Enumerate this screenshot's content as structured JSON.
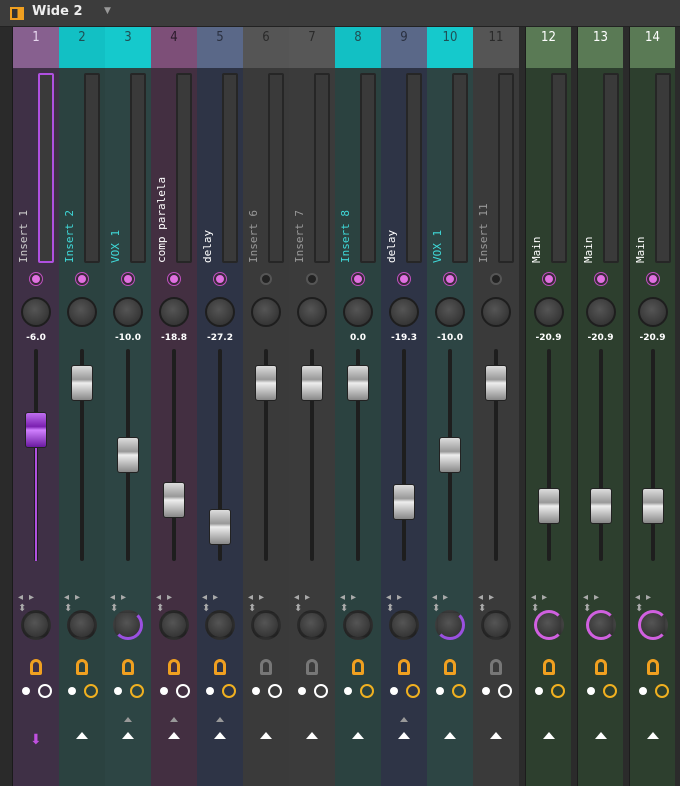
{
  "topbar": {
    "preset_name": "Wide 2"
  },
  "colors": {
    "accent": "#f0a020",
    "selected": "#b050e0",
    "pan_arc": "#9a50e0"
  },
  "strips": [
    {
      "num": "1",
      "name": "Insert 1",
      "vol": "-6.0",
      "hdr": "#87608f",
      "body": "#3f3046",
      "txt": "#e8d8f0",
      "ncol": "#ccc",
      "fader": 0.62,
      "led": true,
      "fx": true,
      "clock": "w",
      "pan": 0,
      "sel": true
    },
    {
      "num": "2",
      "name": "Insert 2",
      "vol": "",
      "hdr": "#12c0c4",
      "body": "#2b4240",
      "txt": "#1f4f55",
      "ncol": "#3fd8d8",
      "fader": 0.84,
      "led": true,
      "fx": true,
      "clock": "y",
      "pan": 0
    },
    {
      "num": "3",
      "name": "VOX 1",
      "vol": "-10.0",
      "hdr": "#15c9cc",
      "body": "#2d4544",
      "txt": "#1f4f55",
      "ncol": "#3fd8d8",
      "fader": 0.5,
      "led": true,
      "fx": true,
      "clock": "y",
      "pan": 0.5,
      "up2": true
    },
    {
      "num": "4",
      "name": "comp paralela",
      "vol": "-18.8",
      "hdr": "#7d4f78",
      "body": "#432f41",
      "txt": "#2a1a2a",
      "ncol": "#fff",
      "fader": 0.29,
      "led": true,
      "fx": true,
      "clock": "w",
      "pan": 0,
      "up2": true
    },
    {
      "num": "5",
      "name": "delay",
      "vol": "-27.2",
      "hdr": "#5a6888",
      "body": "#2e3446",
      "txt": "#2a3040",
      "ncol": "#fff",
      "fader": 0.16,
      "led": true,
      "fx": true,
      "clock": "y",
      "pan": 0,
      "up2": true
    },
    {
      "num": "6",
      "name": "Insert 6",
      "vol": "",
      "hdr": "#555",
      "body": "#3a3a3a",
      "txt": "#2a2a2a",
      "ncol": "#999",
      "fader": 0.84,
      "led": false,
      "fx": false,
      "clock": "w",
      "pan": 0
    },
    {
      "num": "7",
      "name": "Insert 7",
      "vol": "",
      "hdr": "#575757",
      "body": "#3b3b3b",
      "txt": "#2a2a2a",
      "ncol": "#999",
      "fader": 0.84,
      "led": false,
      "fx": false,
      "clock": "w",
      "pan": 0
    },
    {
      "num": "8",
      "name": "Insert 8",
      "vol": "0.0",
      "hdr": "#12c0c4",
      "body": "#2b4240",
      "txt": "#1f4f55",
      "ncol": "#3fd8d8",
      "fader": 0.84,
      "led": true,
      "fx": true,
      "clock": "y",
      "pan": 0
    },
    {
      "num": "9",
      "name": "delay",
      "vol": "-19.3",
      "hdr": "#5a6888",
      "body": "#2e3446",
      "txt": "#2a3040",
      "ncol": "#fff",
      "fader": 0.28,
      "led": true,
      "fx": true,
      "clock": "y",
      "pan": 0,
      "up2": true
    },
    {
      "num": "10",
      "name": "VOX 1",
      "vol": "-10.0",
      "hdr": "#15c9cc",
      "body": "#2d4544",
      "txt": "#1f4f55",
      "ncol": "#3fd8d8",
      "fader": 0.5,
      "led": true,
      "fx": true,
      "clock": "y",
      "pan": 0.5
    },
    {
      "num": "11",
      "name": "Insert 11",
      "vol": "",
      "hdr": "#555",
      "body": "#3a3a3a",
      "txt": "#2a2a2a",
      "ncol": "#999",
      "fader": 0.84,
      "led": false,
      "fx": false,
      "clock": "w",
      "pan": 0
    },
    {
      "num": "12",
      "name": "Main",
      "vol": "-20.9",
      "hdr": "#5a7a55",
      "body": "#2d3f2e",
      "txt": "#fff",
      "ncol": "#fff",
      "fader": 0.26,
      "led": true,
      "fx": true,
      "clock": "y",
      "pan": -1,
      "main": true
    },
    {
      "num": "13",
      "name": "Main",
      "vol": "-20.9",
      "hdr": "#5a7a55",
      "body": "#2d3f2e",
      "txt": "#fff",
      "ncol": "#fff",
      "fader": 0.26,
      "led": true,
      "fx": true,
      "clock": "y",
      "pan": -1,
      "main": true
    },
    {
      "num": "14",
      "name": "Main",
      "vol": "-20.9",
      "hdr": "#5a7a55",
      "body": "#2d3f2e",
      "txt": "#fff",
      "ncol": "#fff",
      "fader": 0.26,
      "led": true,
      "fx": true,
      "clock": "y",
      "pan": -1,
      "main": true
    }
  ]
}
